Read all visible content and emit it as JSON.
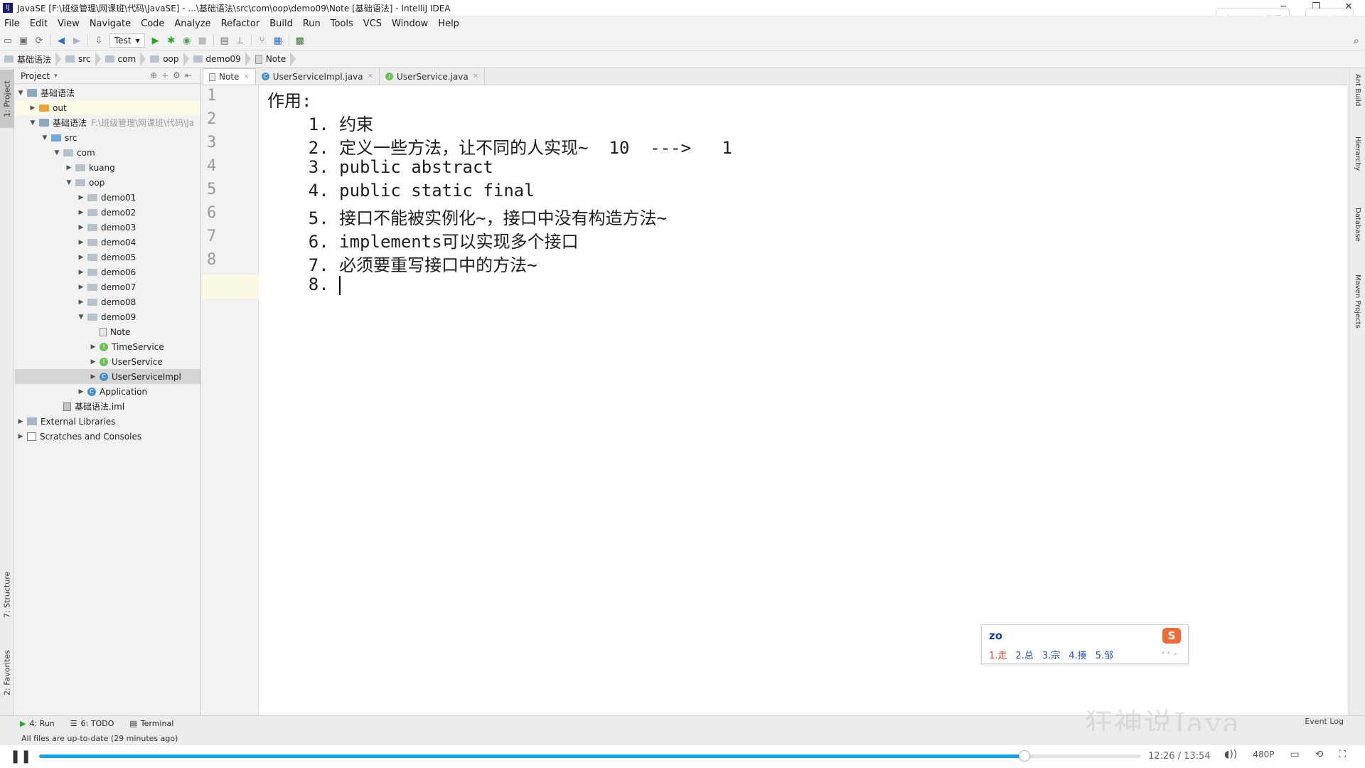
{
  "window": {
    "title": "JavaSE [F:\\班级管理\\网课班\\代码\\JavaSE] - ...\\基础语法\\src\\com\\oop\\demo09\\Note [基础语法] - IntelliJ IDEA",
    "overlay_buttons": [
      "去bilibili观看",
      "分享"
    ]
  },
  "menu": [
    "File",
    "Edit",
    "View",
    "Navigate",
    "Code",
    "Analyze",
    "Refactor",
    "Build",
    "Run",
    "Tools",
    "VCS",
    "Window",
    "Help"
  ],
  "toolbar": {
    "run_config": "Test"
  },
  "breadcrumbs": [
    "基础语法",
    "src",
    "com",
    "oop",
    "demo09",
    "Note"
  ],
  "left_tool_tabs": [
    "1: Project",
    "7: Structure",
    "2: Favorites"
  ],
  "right_tool_tabs": [
    "Ant Build",
    "Hierarchy",
    "Database",
    "Maven Projects"
  ],
  "project": {
    "header": "Project",
    "tree": [
      {
        "label": "基础语法",
        "depth": 0,
        "icon": "module",
        "arrow": "down"
      },
      {
        "label": "out",
        "depth": 1,
        "icon": "folder-orange",
        "arrow": "right",
        "hl": "yellow"
      },
      {
        "label": "基础语法",
        "depth": 1,
        "icon": "module",
        "arrow": "down",
        "hint": "F:\\班级管理\\网课班\\代码\\Ja"
      },
      {
        "label": "src",
        "depth": 2,
        "icon": "folder-blue",
        "arrow": "down"
      },
      {
        "label": "com",
        "depth": 3,
        "icon": "folder",
        "arrow": "down"
      },
      {
        "label": "kuang",
        "depth": 4,
        "icon": "folder",
        "arrow": "right"
      },
      {
        "label": "oop",
        "depth": 4,
        "icon": "folder",
        "arrow": "down"
      },
      {
        "label": "demo01",
        "depth": 5,
        "icon": "folder",
        "arrow": "right"
      },
      {
        "label": "demo02",
        "depth": 5,
        "icon": "folder",
        "arrow": "right"
      },
      {
        "label": "demo03",
        "depth": 5,
        "icon": "folder",
        "arrow": "right"
      },
      {
        "label": "demo04",
        "depth": 5,
        "icon": "folder",
        "arrow": "right"
      },
      {
        "label": "demo05",
        "depth": 5,
        "icon": "folder",
        "arrow": "right"
      },
      {
        "label": "demo06",
        "depth": 5,
        "icon": "folder",
        "arrow": "right"
      },
      {
        "label": "demo07",
        "depth": 5,
        "icon": "folder",
        "arrow": "right"
      },
      {
        "label": "demo08",
        "depth": 5,
        "icon": "folder",
        "arrow": "right"
      },
      {
        "label": "demo09",
        "depth": 5,
        "icon": "folder",
        "arrow": "down"
      },
      {
        "label": "Note",
        "depth": 6,
        "icon": "file",
        "arrow": ""
      },
      {
        "label": "TimeService",
        "depth": 6,
        "icon": "interface",
        "arrow": "right"
      },
      {
        "label": "UserService",
        "depth": 6,
        "icon": "interface",
        "arrow": "right"
      },
      {
        "label": "UserServiceImpl",
        "depth": 6,
        "icon": "class",
        "arrow": "right",
        "selected": true
      },
      {
        "label": "Application",
        "depth": 5,
        "icon": "class",
        "arrow": "right"
      },
      {
        "label": "基础语法.iml",
        "depth": 3,
        "icon": "iml",
        "arrow": ""
      },
      {
        "label": "External Libraries",
        "depth": 0,
        "icon": "library",
        "arrow": "right"
      },
      {
        "label": "Scratches and Consoles",
        "depth": 0,
        "icon": "scratch",
        "arrow": "right"
      }
    ]
  },
  "editor": {
    "tabs": [
      {
        "label": "Note",
        "active": true
      },
      {
        "label": "UserServiceImpl.java",
        "active": false
      },
      {
        "label": "UserService.java",
        "active": false
      }
    ],
    "current_line": 9,
    "lines": [
      "作用:",
      "    1. 约束",
      "    2. 定义一些方法，让不同的人实现~  10  --->   1",
      "    3. public abstract",
      "    4. public static final",
      "    5. 接口不能被实例化~，接口中没有构造方法~",
      "    6. implements可以实现多个接口",
      "    7. 必须要重写接口中的方法~",
      "    8. "
    ]
  },
  "ime": {
    "input": "zo",
    "logo": "S",
    "candidates": [
      "1.走",
      "2.总",
      "3.宗",
      "4.揍",
      "5.邹"
    ]
  },
  "bottom_tools": [
    "4: Run",
    "6: TODO",
    "Terminal"
  ],
  "event_log": "Event Log",
  "status_message": "All files are up-to-date (29 minutes ago)",
  "watermark": "狂神说Java",
  "player": {
    "current_time": "12:26",
    "total_time": "13:54",
    "progress": 0.8945,
    "quality": "480P"
  }
}
